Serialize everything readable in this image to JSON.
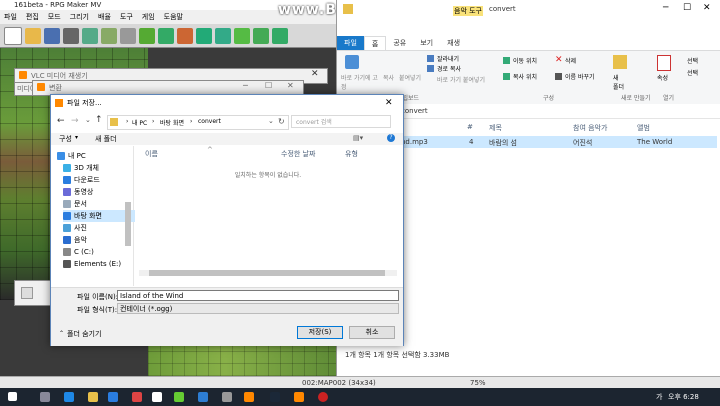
{
  "rpg": {
    "title": "161beta - RPG Maker MV",
    "menu": [
      "파일",
      "편집",
      "모드",
      "그리기",
      "배율",
      "도구",
      "게임",
      "도움말"
    ],
    "status_map": "002:MAP002 (34x34)",
    "status_zoom": "75%"
  },
  "watermark": "www.BANDICAM.com",
  "vlc": {
    "title": "VLC 미디어 재생기",
    "menu_label": "미디어(M)",
    "convert_title": "변환"
  },
  "explorer": {
    "title": "convert",
    "context_tab": "음악 도구",
    "tabs": [
      "파일",
      "홈",
      "공유",
      "보기",
      "재생"
    ],
    "ribbon": {
      "pin_label": "바로 가기에 고정",
      "copy_label": "복사",
      "paste_label": "붙여넣기",
      "cut_label": "잘라내기",
      "copy_path_label": "경로 복사",
      "paste_shortcut_label": "바로 가기 붙여넣기",
      "clipboard_group": "클립보드",
      "move_label": "이동 위치",
      "copy_to_label": "복사 위치",
      "delete_label": "삭제",
      "rename_label": "이름 바꾸기",
      "organize_group": "구성",
      "new_folder_label": "새 폴더",
      "new_group": "새로 만들기",
      "properties_label": "속성",
      "open_group": "열기",
      "select_label": "선택",
      "select2_label": "선택"
    },
    "address": "convert",
    "columns": [
      "#",
      "제목",
      "참여 음악가",
      "앨범"
    ],
    "file": {
      "name": "nd.mp3",
      "number": "4",
      "title": "바람의 섬",
      "artist": "어진석",
      "album": "The World"
    },
    "status": "1개 항목   1개 항목 선택함 3.33MB"
  },
  "dialog": {
    "title": "파일 저장...",
    "path": [
      "내 PC",
      "바탕 화면",
      "convert"
    ],
    "search_placeholder": "convert 검색",
    "organize": "구성",
    "new_folder": "새 폴더",
    "tree": [
      "내 PC",
      "3D 개체",
      "다운로드",
      "동영상",
      "문서",
      "바탕 화면",
      "사진",
      "음악",
      "C (C:)",
      "Elements (E:)"
    ],
    "columns": [
      "이름",
      "수정한 날짜",
      "유형"
    ],
    "empty_message": "일치하는 항목이 없습니다.",
    "filename_label": "파일 이름(N):",
    "filename_value": "Island of the Wind",
    "filetype_label": "파일 형식(T):",
    "filetype_value": "컨테이너 (*.ogg)",
    "hide_folders": "폴더 숨기기",
    "save_button": "저장(S)",
    "cancel_button": "취소"
  },
  "taskbar": {
    "time": "오후 6:28",
    "lang": "가"
  },
  "colors": {
    "accent": "#0078d7",
    "selection": "#cce8ff",
    "taskbar": "#1c2530",
    "music_tools": "#f9e27a"
  }
}
